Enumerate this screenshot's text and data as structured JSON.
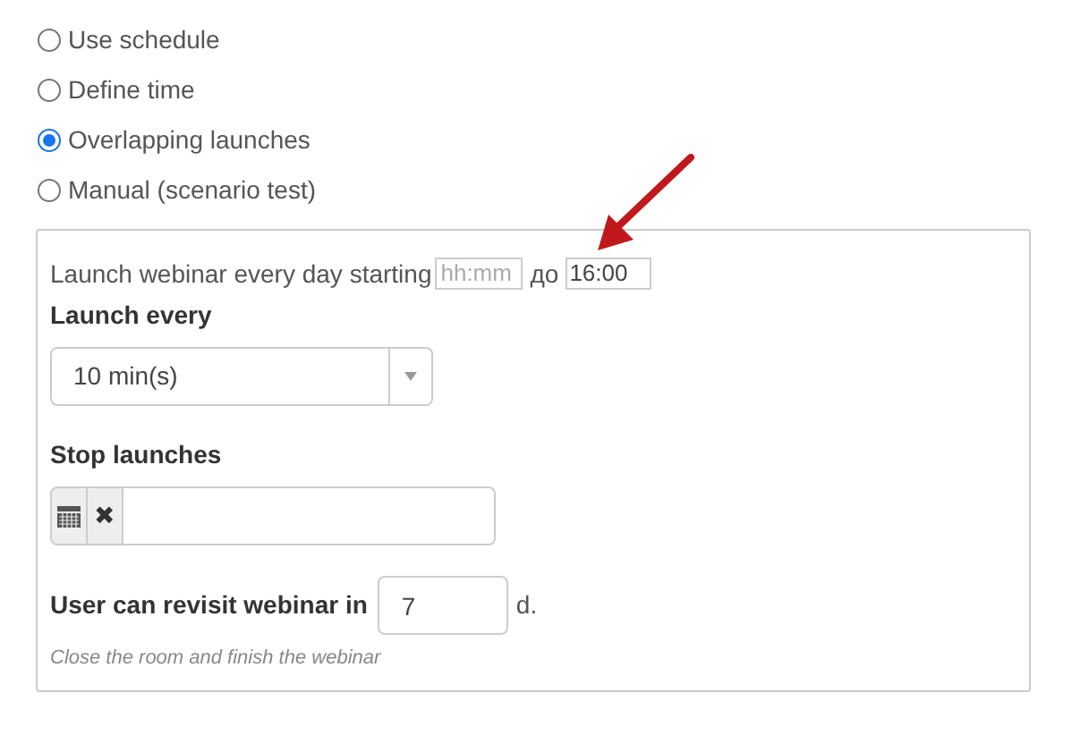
{
  "launch_modes": [
    {
      "label": "Use schedule",
      "selected": false
    },
    {
      "label": "Define time",
      "selected": false
    },
    {
      "label": "Overlapping launches",
      "selected": true
    },
    {
      "label": "Manual (scenario test)",
      "selected": false
    }
  ],
  "panel": {
    "daily_text": "Launch webinar every day starting",
    "start_field": {
      "placeholder": "hh:mm"
    },
    "separator": "до",
    "end_field": {
      "value": "16:00"
    },
    "launch_every": {
      "label": "Launch every",
      "value": "10 min(s)"
    },
    "stop_launches": {
      "label": "Stop launches",
      "clear_button": "✖"
    },
    "revisit": {
      "label": "User can revisit webinar in",
      "value": "7",
      "unit": "d."
    },
    "hint": "Close the room and finish the webinar"
  }
}
